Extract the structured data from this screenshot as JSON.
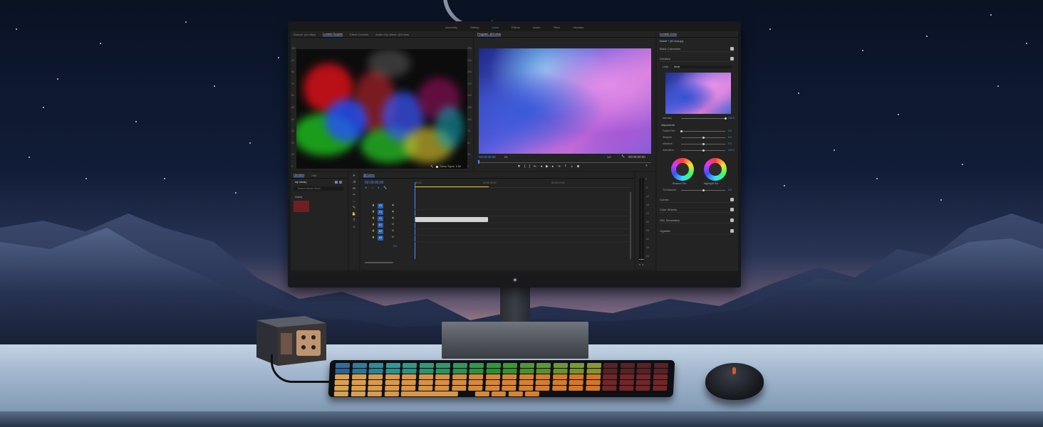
{
  "workspaces": [
    "Assembly",
    "Editing",
    "Color",
    "Effects",
    "Audio",
    "Titles",
    "Libraries"
  ],
  "active_workspace": "Color",
  "scopes_panel": {
    "tabs": [
      "Source: (no clips)",
      "Lumetri Scopes",
      "Effect Controls",
      "Audio Clip Mixer: @Colors"
    ],
    "active_tab": "Lumetri Scopes",
    "scale_left": [
      "100",
      "90",
      "80",
      "70",
      "60",
      "50",
      "40",
      "30",
      "20",
      "10",
      "0"
    ],
    "scale_right": [
      "255",
      "230",
      "204",
      "178",
      "153",
      "128",
      "102",
      "76",
      "51",
      "26",
      "0"
    ],
    "clamp_signal": "Clamp Signal",
    "bit_depth": "8 Bit"
  },
  "program_monitor": {
    "title": "Program: @Colors",
    "timecode_in": "00:00:00:00",
    "fit": "Fit",
    "resolution": "1/2",
    "timecode_out": "00:00:00:00"
  },
  "lumetri": {
    "title": "Lumetri Color",
    "master": "Master * @Colors.jpg",
    "sections": {
      "basic": "Basic Correction",
      "creative": "Creative",
      "curves": "Curves",
      "color_wheels": "Color Wheels",
      "hsl": "HSL Secondary",
      "vignette": "Vignette"
    },
    "look_label": "Look",
    "look_value": "None",
    "intensity": {
      "label": "Intensity",
      "value": "100.0"
    },
    "adjustments": "Adjustments",
    "faded_film": {
      "label": "Faded Film",
      "value": "0.0"
    },
    "sharpen": {
      "label": "Sharpen",
      "value": "0.0"
    },
    "vibrance": {
      "label": "Vibrance",
      "value": "0.0"
    },
    "saturation": {
      "label": "Saturation",
      "value": "100.0"
    },
    "shadow_tint": "Shadow Tint",
    "highlight_tint": "Highlight Tint",
    "tint_balance": {
      "label": "Tint Balance",
      "value": "0.0"
    }
  },
  "libraries": {
    "tabs": [
      "Libraries",
      "Info"
    ],
    "library": "My Library",
    "search_placeholder": "Search Adobe Stock",
    "group": "Colors",
    "swatch_color": "#6e1f24"
  },
  "timeline": {
    "tab": "@Colors",
    "timecode": "00:00:00:00",
    "ruler": [
      ":00:00",
      "00:00:05:00",
      "00:00:10:00"
    ],
    "tracks_video": [
      "V3",
      "V2",
      "V1"
    ],
    "tracks_audio": [
      "A1",
      "A2",
      "A3"
    ],
    "master_value": "0.0",
    "meter_scale": [
      "0",
      "-6",
      "-12",
      "-18",
      "-24",
      "-30",
      "-36",
      "-42",
      "-48",
      "-54"
    ],
    "meter_solo": [
      "S",
      "S"
    ]
  },
  "colors": {
    "accent": "#4c8cff",
    "track": "#2d5fa8"
  }
}
